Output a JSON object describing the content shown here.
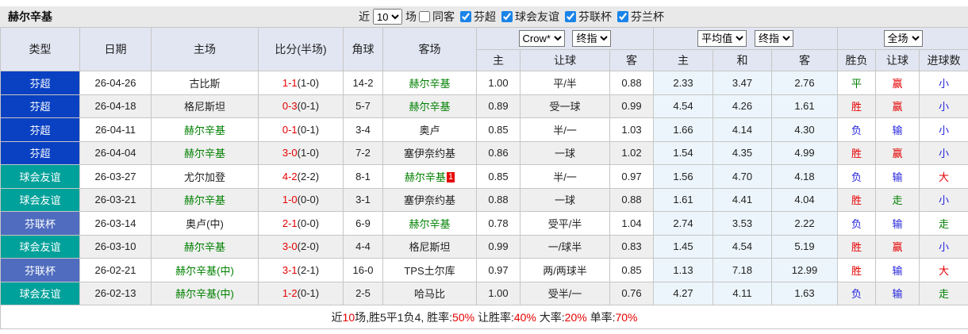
{
  "title": "赫尔辛基",
  "toolbar": {
    "near_label": "近",
    "matches_value": "10",
    "matches_label": "场",
    "same_away_label": "同客",
    "same_away_checked": false,
    "league_filters": [
      {
        "label": "芬超",
        "checked": true
      },
      {
        "label": "球会友谊",
        "checked": true
      },
      {
        "label": "芬联杯",
        "checked": true
      },
      {
        "label": "芬兰杯",
        "checked": true
      }
    ]
  },
  "table": {
    "left_columns": [
      "类型",
      "日期",
      "主场",
      "比分(半场)",
      "角球",
      "客场"
    ],
    "sub_columns": [
      "主",
      "让球",
      "客",
      "主",
      "和",
      "客",
      "胜负",
      "让球",
      "进球数"
    ],
    "selects": {
      "odds_source": "Crow*",
      "odds_time": "终指",
      "avg_source": "平均值",
      "avg_time": "终指",
      "scope": "全场"
    },
    "rows": [
      {
        "type": "芬超",
        "date": "26-04-26",
        "home": "古比斯",
        "home_hl": false,
        "score": "1-1",
        "half": "(1-0)",
        "corner": "14-2",
        "away": "赫尔辛基",
        "away_hl": true,
        "away_badge": "",
        "crow_home": "1.00",
        "handicap": "平/半",
        "crow_away": "0.88",
        "avg_home": "2.33",
        "avg_draw": "3.47",
        "avg_away": "2.76",
        "result": "平",
        "handicap_result": "赢",
        "goals": "小"
      },
      {
        "type": "芬超",
        "date": "26-04-18",
        "home": "格尼斯坦",
        "home_hl": false,
        "score": "0-3",
        "half": "(0-1)",
        "corner": "5-7",
        "away": "赫尔辛基",
        "away_hl": true,
        "away_badge": "",
        "crow_home": "0.89",
        "handicap": "受一球",
        "crow_away": "0.99",
        "avg_home": "4.54",
        "avg_draw": "4.26",
        "avg_away": "1.61",
        "result": "胜",
        "handicap_result": "赢",
        "goals": "小"
      },
      {
        "type": "芬超",
        "date": "26-04-11",
        "home": "赫尔辛基",
        "home_hl": true,
        "score": "0-1",
        "half": "(0-1)",
        "corner": "3-4",
        "away": "奥卢",
        "away_hl": false,
        "away_badge": "",
        "crow_home": "0.85",
        "handicap": "半/一",
        "crow_away": "1.03",
        "avg_home": "1.66",
        "avg_draw": "4.14",
        "avg_away": "4.30",
        "result": "负",
        "handicap_result": "输",
        "goals": "小"
      },
      {
        "type": "芬超",
        "date": "26-04-04",
        "home": "赫尔辛基",
        "home_hl": true,
        "score": "3-0",
        "half": "(1-0)",
        "corner": "7-2",
        "away": "塞伊奈约基",
        "away_hl": false,
        "away_badge": "",
        "crow_home": "0.86",
        "handicap": "一球",
        "crow_away": "1.02",
        "avg_home": "1.54",
        "avg_draw": "4.35",
        "avg_away": "4.99",
        "result": "胜",
        "handicap_result": "赢",
        "goals": "小"
      },
      {
        "type": "球会友谊",
        "date": "26-03-27",
        "home": "尤尔加登",
        "home_hl": false,
        "score": "4-2",
        "half": "(2-2)",
        "corner": "8-1",
        "away": "赫尔辛基",
        "away_hl": true,
        "away_badge": "1",
        "crow_home": "0.85",
        "handicap": "半/一",
        "crow_away": "0.97",
        "avg_home": "1.56",
        "avg_draw": "4.70",
        "avg_away": "4.18",
        "result": "负",
        "handicap_result": "输",
        "goals": "大"
      },
      {
        "type": "球会友谊",
        "date": "26-03-21",
        "home": "赫尔辛基",
        "home_hl": true,
        "score": "1-0",
        "half": "(0-0)",
        "corner": "3-1",
        "away": "塞伊奈约基",
        "away_hl": false,
        "away_badge": "",
        "crow_home": "0.88",
        "handicap": "一球",
        "crow_away": "0.88",
        "avg_home": "1.61",
        "avg_draw": "4.41",
        "avg_away": "4.04",
        "result": "胜",
        "handicap_result": "走",
        "goals": "小"
      },
      {
        "type": "芬联杯",
        "date": "26-03-14",
        "home": "奥卢(中)",
        "home_hl": false,
        "score": "2-1",
        "half": "(0-0)",
        "corner": "6-9",
        "away": "赫尔辛基",
        "away_hl": true,
        "away_badge": "",
        "crow_home": "0.78",
        "handicap": "受平/半",
        "crow_away": "1.04",
        "avg_home": "2.74",
        "avg_draw": "3.53",
        "avg_away": "2.22",
        "result": "负",
        "handicap_result": "输",
        "goals": "走"
      },
      {
        "type": "球会友谊",
        "date": "26-03-10",
        "home": "赫尔辛基",
        "home_hl": true,
        "score": "3-0",
        "half": "(2-0)",
        "corner": "4-4",
        "away": "格尼斯坦",
        "away_hl": false,
        "away_badge": "",
        "crow_home": "0.99",
        "handicap": "一/球半",
        "crow_away": "0.83",
        "avg_home": "1.45",
        "avg_draw": "4.54",
        "avg_away": "5.19",
        "result": "胜",
        "handicap_result": "赢",
        "goals": "小"
      },
      {
        "type": "芬联杯",
        "date": "26-02-21",
        "home": "赫尔辛基(中)",
        "home_hl": true,
        "score": "3-1",
        "half": "(2-1)",
        "corner": "16-0",
        "away": "TPS土尔库",
        "away_hl": false,
        "away_badge": "",
        "crow_home": "0.97",
        "handicap": "两/两球半",
        "crow_away": "0.85",
        "avg_home": "1.13",
        "avg_draw": "7.18",
        "avg_away": "12.99",
        "result": "胜",
        "handicap_result": "输",
        "goals": "大"
      },
      {
        "type": "球会友谊",
        "date": "26-02-13",
        "home": "赫尔辛基(中)",
        "home_hl": true,
        "score": "1-2",
        "half": "(0-1)",
        "corner": "2-5",
        "away": "哈马比",
        "away_hl": false,
        "away_badge": "",
        "crow_home": "1.00",
        "handicap": "受半/一",
        "crow_away": "0.76",
        "avg_home": "4.27",
        "avg_draw": "4.11",
        "avg_away": "1.63",
        "result": "负",
        "handicap_result": "输",
        "goals": "走"
      }
    ]
  },
  "footer": {
    "segments": [
      {
        "text": "近",
        "red": false
      },
      {
        "text": "10",
        "red": true
      },
      {
        "text": "场,胜5平1负4, 胜率:",
        "red": false
      },
      {
        "text": "50%",
        "red": true
      },
      {
        "text": " 让胜率:",
        "red": false
      },
      {
        "text": "40%",
        "red": true
      },
      {
        "text": " 大率:",
        "red": false
      },
      {
        "text": "20%",
        "red": true
      },
      {
        "text": " 单率:",
        "red": false
      },
      {
        "text": "70%",
        "red": true
      }
    ]
  },
  "colors": {
    "red": "#e60000",
    "green": "#008000",
    "blue": "#2525dd",
    "types": {
      "芬超": "#0a41c2",
      "球会友谊": "#00a19a",
      "芬联杯": "#4f6cbe"
    },
    "outcome_colors": {
      "胜": "red",
      "平": "green",
      "负": "blue",
      "赢": "red",
      "走": "green",
      "输": "blue",
      "大": "red",
      "小": "blue"
    },
    "header_bg": "#e2e6f2",
    "titlebar_bg": "#e9e9e9",
    "avg_col_bg": "#ecf5fb",
    "stripe_bg": "#efefef",
    "badge_bg": "#e60000",
    "checkbox_accent": "#1a84e8"
  }
}
